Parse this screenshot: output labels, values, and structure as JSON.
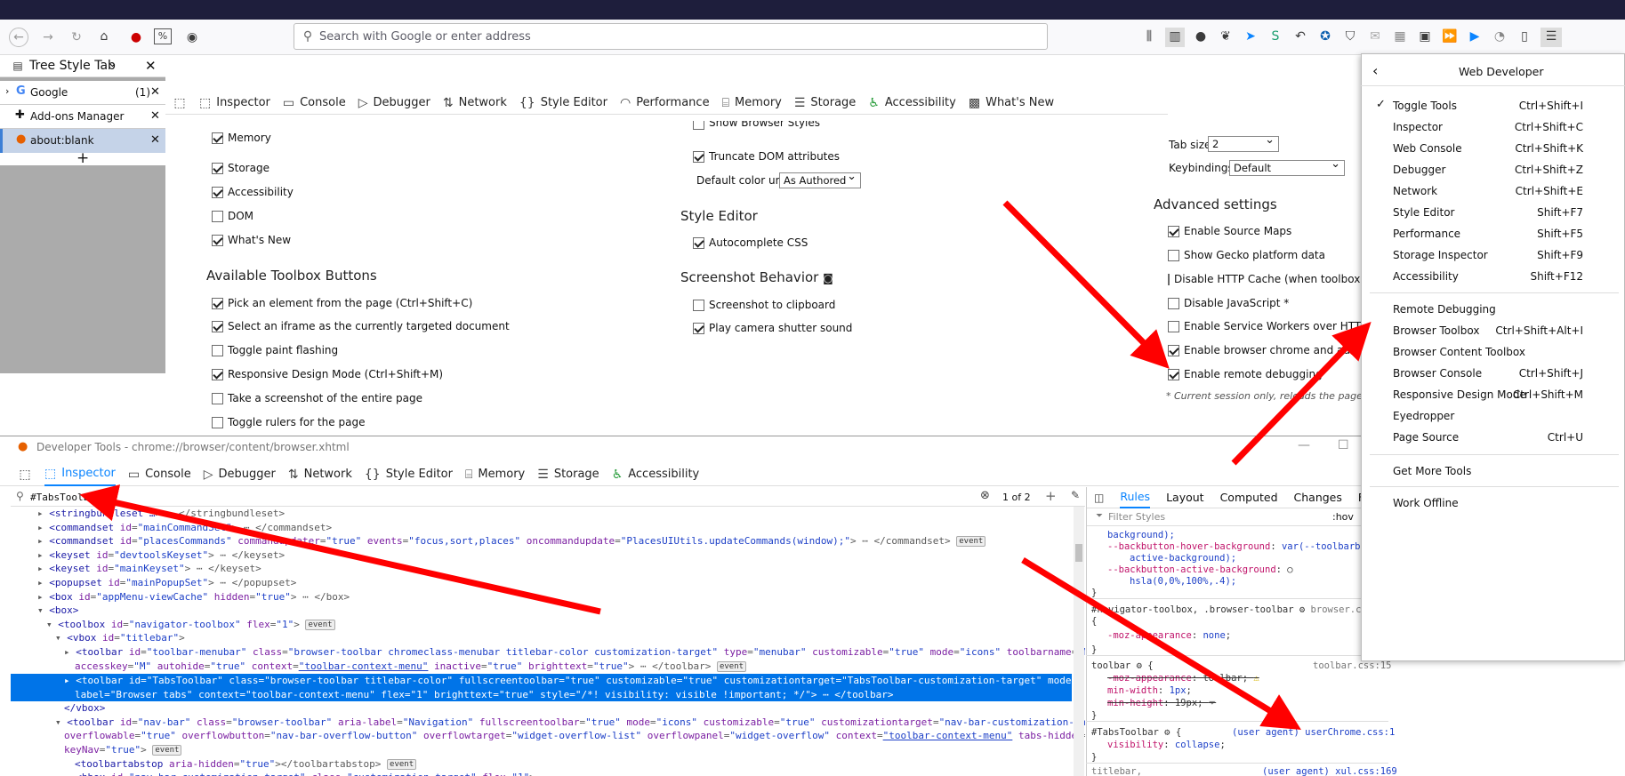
{
  "nav": {
    "address_placeholder": "Search with Google or enter address"
  },
  "sidebar": {
    "title": "Tree Style Tab",
    "tabs": [
      {
        "label": "Google",
        "count": "(1)"
      },
      {
        "label": "Add-ons Manager",
        "count": ""
      },
      {
        "label": "about:blank",
        "count": ""
      }
    ],
    "new_tab": "+"
  },
  "top_toolbox": {
    "tabs": [
      "Inspector",
      "Console",
      "Debugger",
      "Network",
      "Style Editor",
      "Performance",
      "Memory",
      "Storage",
      "Accessibility",
      "What's New"
    ]
  },
  "settings": {
    "col1_options": [
      {
        "label": "Memory",
        "checked": true
      },
      {
        "label": "Storage",
        "checked": true
      },
      {
        "label": "Accessibility",
        "checked": true
      },
      {
        "label": "DOM",
        "checked": false
      },
      {
        "label": "What's New",
        "checked": true
      }
    ],
    "available_heading": "Available Toolbox Buttons",
    "available_options": [
      {
        "label": "Pick an element from the page (Ctrl+Shift+C)",
        "checked": true
      },
      {
        "label": "Select an iframe as the currently targeted document",
        "checked": true
      },
      {
        "label": "Toggle paint flashing",
        "checked": false
      },
      {
        "label": "Responsive Design Mode (Ctrl+Shift+M)",
        "checked": true
      },
      {
        "label": "Take a screenshot of the entire page",
        "checked": false
      },
      {
        "label": "Toggle rulers for the page",
        "checked": false
      }
    ],
    "col2_partial": "Show Browser Styles",
    "col2_truncate": "Truncate DOM attributes",
    "default_color_label": "Default color unit",
    "default_color_value": "As Authored",
    "style_editor_heading": "Style Editor",
    "autocomplete": "Autocomplete CSS",
    "screenshot_heading": "Screenshot Behavior",
    "screenshot_clipboard": "Screenshot to clipboard",
    "camera_sound": "Play camera shutter sound",
    "tab_size_label": "Tab size",
    "tab_size_value": "2",
    "keybindings_label": "Keybindings",
    "keybindings_value": "Default",
    "advanced_heading": "Advanced settings",
    "advanced_options": [
      {
        "label": "Enable Source Maps",
        "checked": true
      },
      {
        "label": "Show Gecko platform data",
        "checked": false
      },
      {
        "label": "Disable HTTP Cache (when toolbox is o",
        "checked": false
      },
      {
        "label": "Disable JavaScript *",
        "checked": false
      },
      {
        "label": "Enable Service Workers over HTTP (whe",
        "checked": false
      },
      {
        "label": "Enable browser chrome and add-on",
        "checked": true
      },
      {
        "label": "Enable remote debugging",
        "checked": true
      }
    ],
    "footnote": "* Current session only, reloads the page"
  },
  "devtools": {
    "window_title": "Developer Tools - chrome://browser/content/browser.xhtml",
    "tabs": [
      "Inspector",
      "Console",
      "Debugger",
      "Network",
      "Style Editor",
      "Memory",
      "Storage",
      "Accessibility"
    ],
    "search_value": "#TabsToolbar",
    "search_count": "1 of 2",
    "rules_tabs": [
      "Rules",
      "Layout",
      "Computed",
      "Changes",
      "Fo"
    ],
    "filter_placeholder": "Filter Styles",
    "hov": ":hov"
  },
  "menu": {
    "title": "Web Developer",
    "groups": [
      [
        {
          "label": "Toggle Tools",
          "key": "Ctrl+Shift+I",
          "checked": true
        },
        {
          "label": "Inspector",
          "key": "Ctrl+Shift+C"
        },
        {
          "label": "Web Console",
          "key": "Ctrl+Shift+K"
        },
        {
          "label": "Debugger",
          "key": "Ctrl+Shift+Z"
        },
        {
          "label": "Network",
          "key": "Ctrl+Shift+E"
        },
        {
          "label": "Style Editor",
          "key": "Shift+F7"
        },
        {
          "label": "Performance",
          "key": "Shift+F5"
        },
        {
          "label": "Storage Inspector",
          "key": "Shift+F9"
        },
        {
          "label": "Accessibility",
          "key": "Shift+F12"
        }
      ],
      [
        {
          "label": "Remote Debugging",
          "key": ""
        },
        {
          "label": "Browser Toolbox",
          "key": "Ctrl+Shift+Alt+I"
        },
        {
          "label": "Browser Content Toolbox",
          "key": ""
        },
        {
          "label": "Browser Console",
          "key": "Ctrl+Shift+J"
        },
        {
          "label": "Responsive Design Mode",
          "key": "Ctrl+Shift+M"
        },
        {
          "label": "Eyedropper",
          "key": ""
        },
        {
          "label": "Page Source",
          "key": "Ctrl+U"
        }
      ],
      [
        {
          "label": "Get More Tools",
          "key": ""
        }
      ],
      [
        {
          "label": "Work Offline",
          "key": ""
        }
      ]
    ]
  },
  "colors": {
    "selection": "#0074e8",
    "accent": "#0a84ff",
    "arrow": "#ff0000",
    "titlebar": "#1d1d3b"
  }
}
